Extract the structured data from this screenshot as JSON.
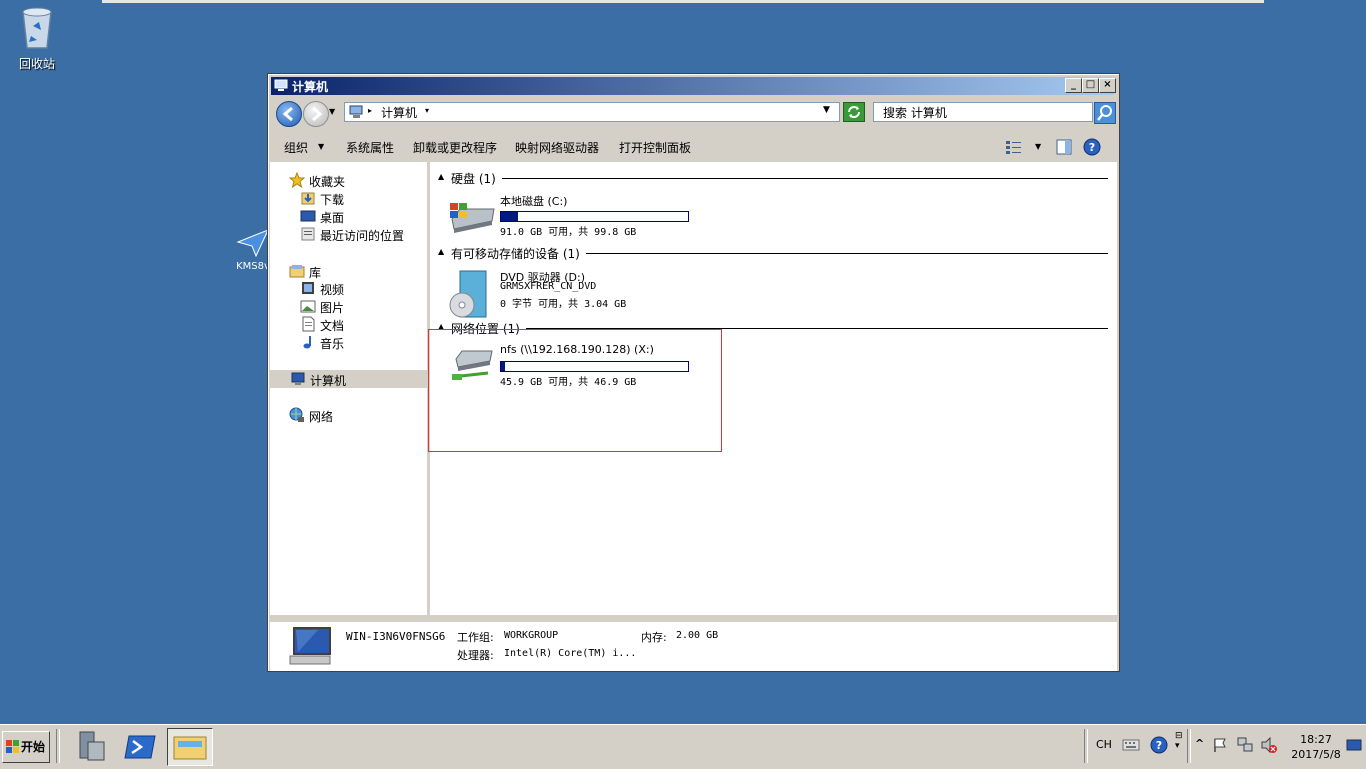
{
  "desktop": {
    "recycle_bin": "回收站",
    "kms_shortcut": "KMS8v"
  },
  "window": {
    "title": "计算机",
    "buttons": {
      "minimize": "_",
      "maximize": "□",
      "close": "×"
    }
  },
  "address_bar": {
    "path": "计算机",
    "search_placeholder": "搜索 计算机"
  },
  "command_bar": {
    "items": [
      "组织",
      "系统属性",
      "卸载或更改程序",
      "映射网络驱动器",
      "打开控制面板"
    ]
  },
  "nav_pane": {
    "favorites": "收藏夹",
    "downloads": "下载",
    "desktop": "桌面",
    "recent": "最近访问的位置",
    "libraries": "库",
    "videos": "视频",
    "pictures": "图片",
    "documents": "文档",
    "music": "音乐",
    "computer": "计算机",
    "network": "网络"
  },
  "groups": {
    "hdd": "硬盘 (1)",
    "removable": "有可移动存储的设备 (1)",
    "network": "网络位置 (1)"
  },
  "drives": {
    "c": {
      "name": "本地磁盘 (C:)",
      "info": "91.0 GB 可用，共 99.8 GB",
      "used_fraction": 0.09
    },
    "d": {
      "name": "DVD 驱动器 (D:)",
      "label": "GRMSXFRER_CN_DVD",
      "info": "0 字节 可用，共 3.04 GB"
    },
    "x": {
      "name": "nfs (\\\\192.168.190.128) (X:)",
      "info": "45.9 GB 可用，共 46.9 GB",
      "used_fraction": 0.02
    }
  },
  "details": {
    "computer_name": "WIN-I3N6V0FNSG6",
    "workgroup_label": "工作组:",
    "workgroup": "WORKGROUP",
    "memory_label": "内存:",
    "memory": "2.00 GB",
    "processor_label": "处理器:",
    "processor": "Intel(R) Core(TM) i..."
  },
  "taskbar": {
    "start": "开始",
    "lang": "CH",
    "time": "18:27",
    "date": "2017/5/8"
  }
}
